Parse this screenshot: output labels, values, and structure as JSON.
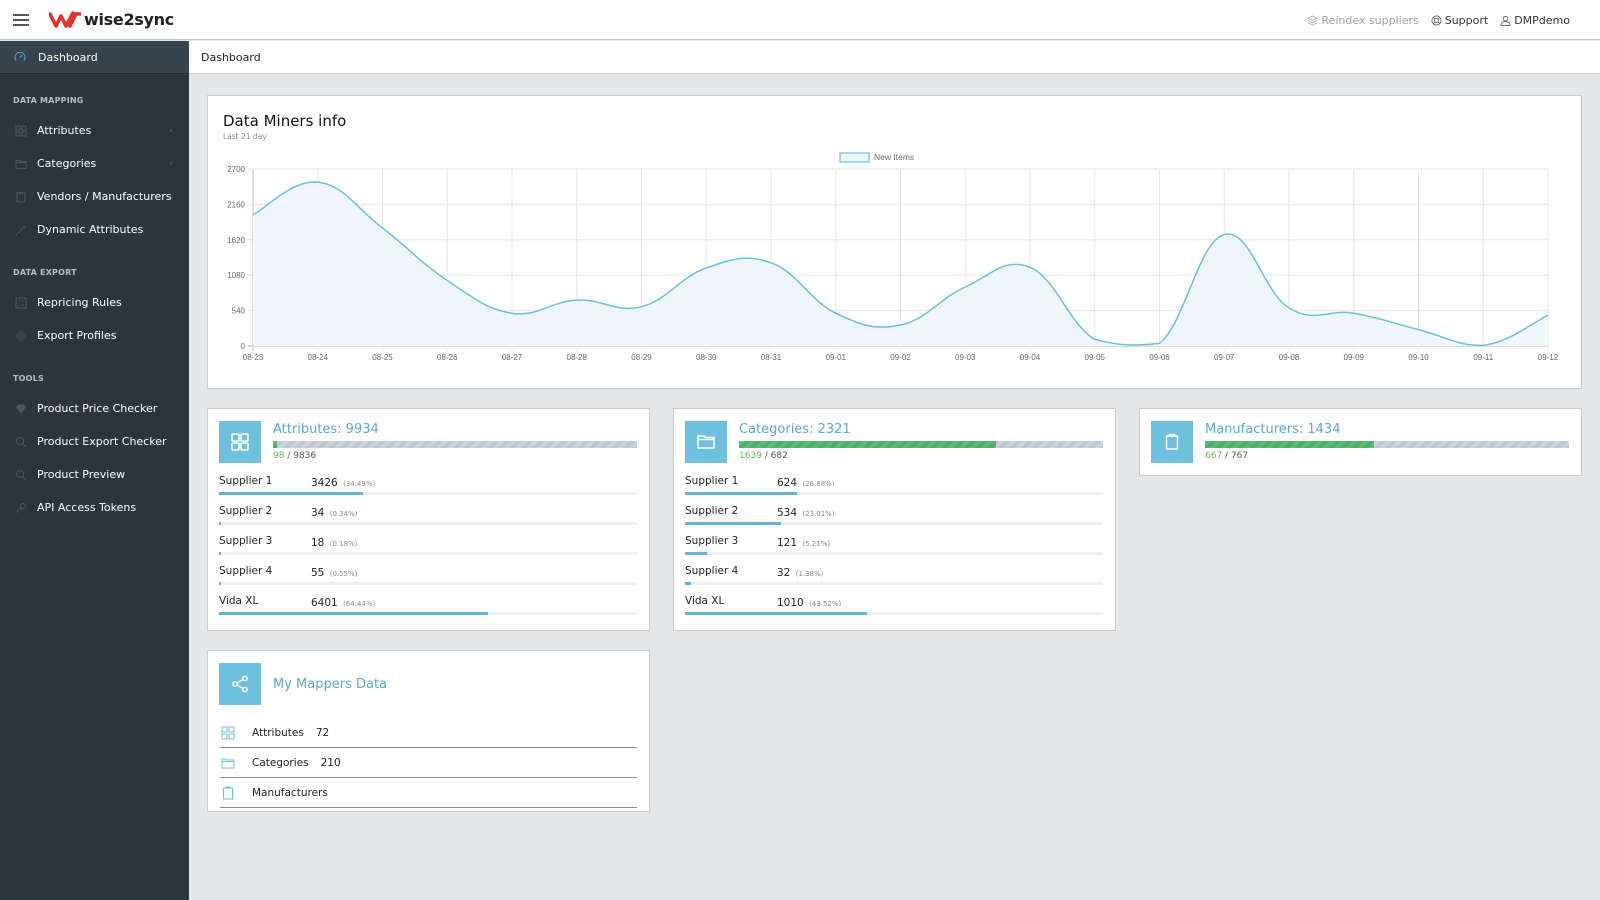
{
  "app": {
    "brand": "wise2sync",
    "brand_color": "#e5322d"
  },
  "topbar": {
    "reindex_label": "Reindex suppliers",
    "support_label": "Support",
    "user_label": "DMPdemo"
  },
  "breadcrumb": {
    "current": "Dashboard"
  },
  "sidebar": {
    "active": {
      "label": "Dashboard",
      "icon": "dashboard-icon"
    },
    "sections": [
      {
        "title": "DATA MAPPING",
        "items": [
          {
            "label": "Attributes",
            "icon": "grid-icon",
            "has_submenu": true
          },
          {
            "label": "Categories",
            "icon": "folder-icon",
            "has_submenu": true
          },
          {
            "label": "Vendors / Manufacturers",
            "icon": "clipboard-icon",
            "has_submenu": true
          },
          {
            "label": "Dynamic Attributes",
            "icon": "magic-wand-icon",
            "has_submenu": false
          }
        ]
      },
      {
        "title": "DATA EXPORT",
        "items": [
          {
            "label": "Repricing Rules",
            "icon": "calculator-icon",
            "has_submenu": false
          },
          {
            "label": "Export Profiles",
            "icon": "gear-icon",
            "has_submenu": false
          }
        ]
      },
      {
        "title": "TOOLS",
        "items": [
          {
            "label": "Product Price Checker",
            "icon": "diamond-icon",
            "has_submenu": false
          },
          {
            "label": "Product Export Checker",
            "icon": "search-icon",
            "has_submenu": false
          },
          {
            "label": "Product Preview",
            "icon": "search-icon",
            "has_submenu": false
          },
          {
            "label": "API Access Tokens",
            "icon": "key-icon",
            "has_submenu": false
          }
        ]
      }
    ]
  },
  "chart_data": {
    "type": "line",
    "title": "Data Miners info",
    "subtitle": "Last 21 day",
    "xlabel": "",
    "ylabel": "",
    "ylim": [
      0,
      2700
    ],
    "yticks": [
      0,
      540,
      1080,
      1620,
      2160,
      2700
    ],
    "grid": true,
    "legend_position": "top-center",
    "x": [
      "08-23",
      "08-24",
      "08-25",
      "08-26",
      "08-27",
      "08-28",
      "08-29",
      "08-30",
      "08-31",
      "09-01",
      "09-02",
      "09-03",
      "09-04",
      "09-05",
      "09-06",
      "09-07",
      "09-08",
      "09-09",
      "09-10",
      "09-11",
      "09-12"
    ],
    "series": [
      {
        "name": "New Items",
        "color": "#6cbfde",
        "fill": "#eef6fa",
        "values": [
          2000,
          2500,
          1800,
          1000,
          500,
          700,
          600,
          1190,
          1270,
          500,
          320,
          900,
          1200,
          100,
          40,
          1700,
          580,
          500,
          250,
          10,
          470
        ]
      }
    ]
  },
  "stats": [
    {
      "title": "Attributes: 9934",
      "icon": "grid-icon",
      "done": "98",
      "total": "9836",
      "progress_fraction": 0.01,
      "rows": [
        {
          "name": "Supplier 1",
          "value": "3426",
          "pct": "(34.49%)",
          "fraction": 0.3449
        },
        {
          "name": "Supplier 2",
          "value": "34",
          "pct": "(0.34%)",
          "fraction": 0.0034
        },
        {
          "name": "Supplier 3",
          "value": "18",
          "pct": "(0.18%)",
          "fraction": 0.0018
        },
        {
          "name": "Supplier 4",
          "value": "55",
          "pct": "(0.55%)",
          "fraction": 0.0055
        },
        {
          "name": "Vida XL",
          "value": "6401",
          "pct": "(64.44%)",
          "fraction": 0.6444
        }
      ]
    },
    {
      "title": "Categories: 2321",
      "icon": "folder-icon",
      "done": "1639",
      "total": "682",
      "progress_fraction": 0.706,
      "rows": [
        {
          "name": "Supplier 1",
          "value": "624",
          "pct": "(26.88%)",
          "fraction": 0.2688
        },
        {
          "name": "Supplier 2",
          "value": "534",
          "pct": "(23.01%)",
          "fraction": 0.2301
        },
        {
          "name": "Supplier 3",
          "value": "121",
          "pct": "(5.21%)",
          "fraction": 0.0521
        },
        {
          "name": "Supplier 4",
          "value": "32",
          "pct": "(1.38%)",
          "fraction": 0.0138
        },
        {
          "name": "Vida XL",
          "value": "1010",
          "pct": "(43.52%)",
          "fraction": 0.4352
        }
      ]
    },
    {
      "title": "Manufacturers: 1434",
      "icon": "clipboard-icon",
      "done": "667",
      "total": "767",
      "progress_fraction": 0.465,
      "rows": []
    }
  ],
  "mappers": {
    "title": "My Mappers Data",
    "icon": "share-icon",
    "rows": [
      {
        "label": "Attributes",
        "value": "72",
        "icon": "grid-icon"
      },
      {
        "label": "Categories",
        "value": "210",
        "icon": "folder-icon"
      },
      {
        "label": "Manufacturers",
        "value": "",
        "icon": "clipboard-icon"
      }
    ]
  }
}
